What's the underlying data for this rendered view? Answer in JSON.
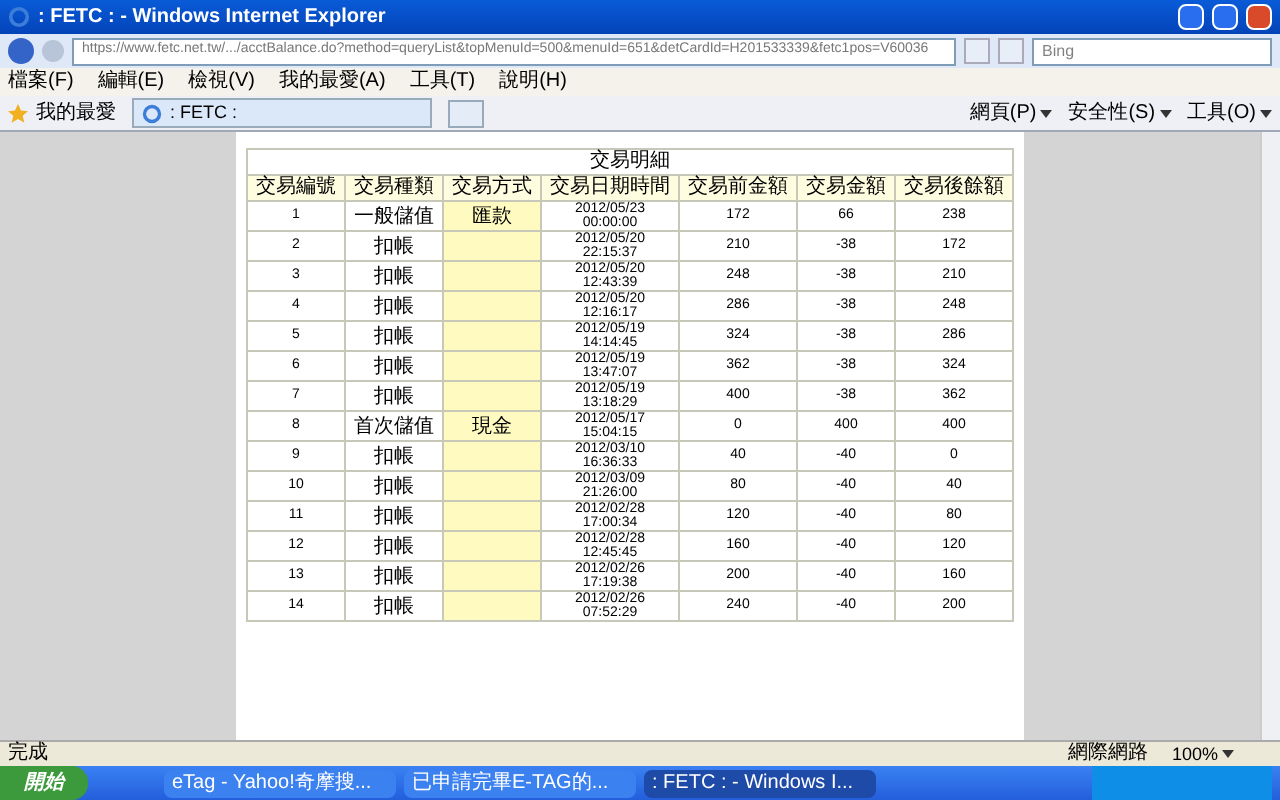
{
  "window": {
    "title": ": FETC : - Windows Internet Explorer"
  },
  "address_bar": {
    "url": "https://www.fetc.net.tw/.../acctBalance.do?method=queryList&topMenuId=500&menuId=651&detCardId=H201533339&fetc1pos=V60036"
  },
  "search": {
    "placeholder": "Bing"
  },
  "menu": [
    "檔案(F)",
    "編輯(E)",
    "檢視(V)",
    "我的最愛(A)",
    "工具(T)",
    "說明(H)"
  ],
  "favorites_bar": {
    "favorites": "我的最愛",
    "tabs": [
      {
        "label": ": FETC :",
        "selected": true
      }
    ],
    "commands": [
      "網頁(P)",
      "安全性(S)",
      "工具(O)"
    ]
  },
  "table": {
    "title": "交易明細",
    "columns": [
      "交易編號",
      "交易種類",
      "交易方式",
      "交易日期時間",
      "交易前金額",
      "交易金額",
      "交易後餘額"
    ],
    "rows": [
      {
        "no": "1",
        "type": "一般儲值",
        "method": "匯款",
        "date": "2012/05/23",
        "time": "00:00:00",
        "before": "172",
        "amount": "66",
        "after": "238"
      },
      {
        "no": "2",
        "type": "扣帳",
        "method": "",
        "date": "2012/05/20",
        "time": "22:15:37",
        "before": "210",
        "amount": "-38",
        "after": "172"
      },
      {
        "no": "3",
        "type": "扣帳",
        "method": "",
        "date": "2012/05/20",
        "time": "12:43:39",
        "before": "248",
        "amount": "-38",
        "after": "210"
      },
      {
        "no": "4",
        "type": "扣帳",
        "method": "",
        "date": "2012/05/20",
        "time": "12:16:17",
        "before": "286",
        "amount": "-38",
        "after": "248"
      },
      {
        "no": "5",
        "type": "扣帳",
        "method": "",
        "date": "2012/05/19",
        "time": "14:14:45",
        "before": "324",
        "amount": "-38",
        "after": "286"
      },
      {
        "no": "6",
        "type": "扣帳",
        "method": "",
        "date": "2012/05/19",
        "time": "13:47:07",
        "before": "362",
        "amount": "-38",
        "after": "324"
      },
      {
        "no": "7",
        "type": "扣帳",
        "method": "",
        "date": "2012/05/19",
        "time": "13:18:29",
        "before": "400",
        "amount": "-38",
        "after": "362"
      },
      {
        "no": "8",
        "type": "首次儲值",
        "method": "現金",
        "date": "2012/05/17",
        "time": "15:04:15",
        "before": "0",
        "amount": "400",
        "after": "400"
      },
      {
        "no": "9",
        "type": "扣帳",
        "method": "",
        "date": "2012/03/10",
        "time": "16:36:33",
        "before": "40",
        "amount": "-40",
        "after": "0"
      },
      {
        "no": "10",
        "type": "扣帳",
        "method": "",
        "date": "2012/03/09",
        "time": "21:26:00",
        "before": "80",
        "amount": "-40",
        "after": "40"
      },
      {
        "no": "11",
        "type": "扣帳",
        "method": "",
        "date": "2012/02/28",
        "time": "17:00:34",
        "before": "120",
        "amount": "-40",
        "after": "80"
      },
      {
        "no": "12",
        "type": "扣帳",
        "method": "",
        "date": "2012/02/28",
        "time": "12:45:45",
        "before": "160",
        "amount": "-40",
        "after": "120"
      },
      {
        "no": "13",
        "type": "扣帳",
        "method": "",
        "date": "2012/02/26",
        "time": "17:19:38",
        "before": "200",
        "amount": "-40",
        "after": "160"
      },
      {
        "no": "14",
        "type": "扣帳",
        "method": "",
        "date": "2012/02/26",
        "time": "07:52:29",
        "before": "240",
        "amount": "-40",
        "after": "200"
      }
    ]
  },
  "status_bar": {
    "status": "完成",
    "zone": "網際網路",
    "zoom": "100%"
  },
  "taskbar": {
    "start": "開始",
    "tasks": [
      {
        "label": "eTag - Yahoo!奇摩搜...",
        "selected": false
      },
      {
        "label": "已申請完畢E-TAG的...",
        "selected": false
      },
      {
        "label": ": FETC : - Windows I...",
        "selected": true
      }
    ]
  }
}
